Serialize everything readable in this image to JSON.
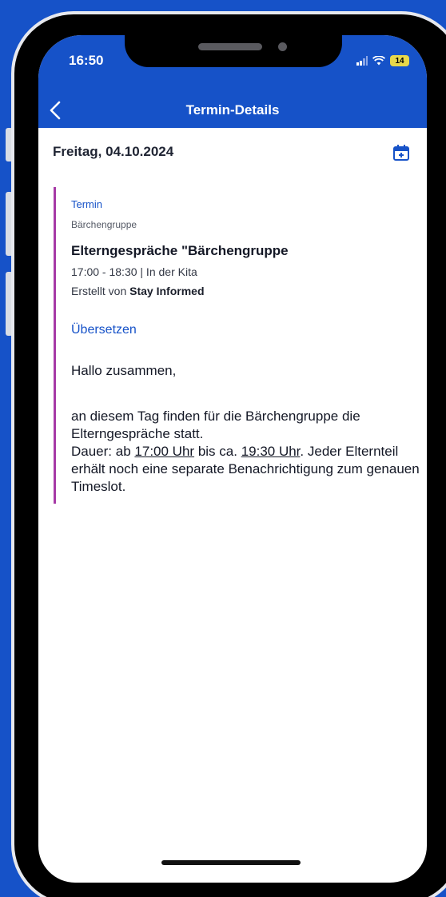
{
  "status": {
    "time": "16:50",
    "battery": "14"
  },
  "navbar": {
    "title": "Termin-Details"
  },
  "date_header": {
    "date": "Freitag, 04.10.2024"
  },
  "event": {
    "type": "Termin",
    "group": "Bärchengruppe",
    "title": "Elterngespräche \"Bärchengruppe",
    "time_location": "17:00 - 18:30 | In der Kita",
    "created_prefix": "Erstellt von",
    "created_by": "Stay Informed",
    "translate_link": "Übersetzen",
    "greeting": "Hallo zusammen,",
    "body_line1": "an diesem Tag finden für die Bärchengruppe die Elterngespräche statt.",
    "body_dauer": "Dauer: ab",
    "body_time1": "17:00 Uhr",
    "body_mid": "bis ca.",
    "body_time2": "19:30 Uhr",
    "body_rest": ". Jeder Elternteil erhält noch eine separate Benachrichtigung zum genauen Timeslot."
  },
  "colors": {
    "brand_blue": "#1652c8",
    "accent_purple": "#a63aa6"
  },
  "icons": {
    "back": "chevron-left-icon",
    "calendar": "calendar-add-icon",
    "signal": "signal-icon",
    "wifi": "wifi-icon",
    "battery": "battery-icon"
  }
}
